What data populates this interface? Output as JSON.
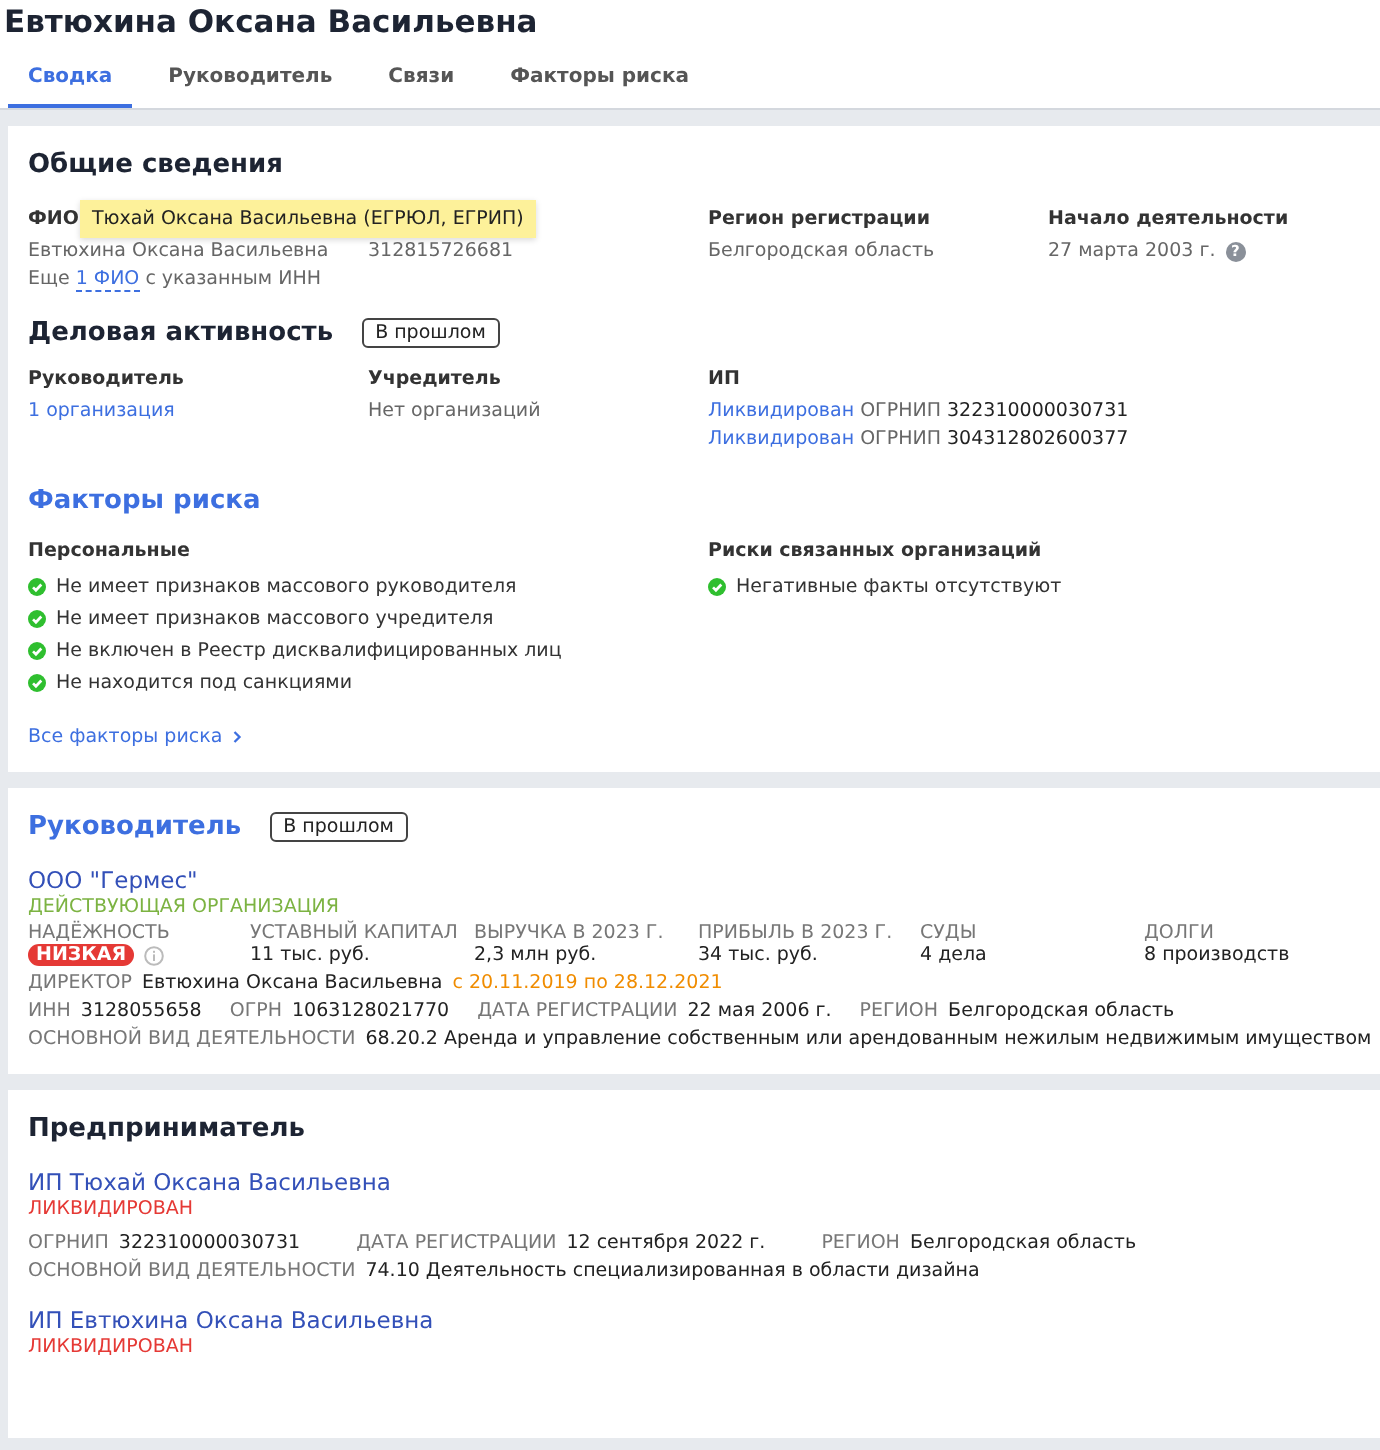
{
  "title": "Евтюхина Оксана Васильевна",
  "tabs": [
    {
      "label": "Сводка",
      "selected": true
    },
    {
      "label": "Руководитель",
      "selected": false
    },
    {
      "label": "Связи",
      "selected": false
    },
    {
      "label": "Факторы риска",
      "selected": false
    }
  ],
  "general": {
    "heading": "Общие сведения",
    "fio_label": "ФИО",
    "fio": "Евтюхина Оксана Васильевна",
    "inn": "312815726681",
    "more_prefix": "Еще",
    "more_link": "1 ФИО",
    "more_suffix": "с указанным ИНН",
    "tooltip": "Тюхай Оксана Васильевна (ЕГРЮЛ, ЕГРИП)",
    "region_label": "Регион регистрации",
    "region": "Белгородская область",
    "start_label": "Начало деятельности",
    "start": "27 марта 2003 г.",
    "start_help": "?"
  },
  "activity": {
    "heading": "Деловая активность",
    "filter": "В прошлом",
    "columns": [
      {
        "label": "Руководитель",
        "lines": [
          {
            "link": "1 организация"
          }
        ]
      },
      {
        "label": "Учредитель",
        "lines": [
          {
            "text": "Нет организаций"
          }
        ]
      },
      {
        "label": "ИП",
        "lines": [
          {
            "link": "Ликвидирован",
            "caption": "ОГРНИП",
            "value": "322310000030731"
          },
          {
            "link": "Ликвидирован",
            "caption": "ОГРНИП",
            "value": "304312802600377"
          }
        ]
      }
    ]
  },
  "risk": {
    "heading": "Факторы риска",
    "groups": [
      {
        "title": "Персональные",
        "items": [
          {
            "text": "Не имеет признаков массового руководителя",
            "ok": true
          },
          {
            "text": "Не имеет признаков массового учредителя",
            "ok": true
          },
          {
            "text": "Не включен в Реестр дисквалифицированных лиц",
            "ok": true
          },
          {
            "text": "Не находится под санкциями",
            "ok": true
          }
        ]
      },
      {
        "title": "Риски связанных организаций",
        "items": [
          {
            "text": "Негативные факты отсутствуют",
            "ok": true
          }
        ]
      }
    ],
    "all_link": "Все факторы риска"
  },
  "manager": {
    "heading": "Руководитель",
    "filter": "В прошлом",
    "company": {
      "name": "ООО \"Гермес\"",
      "status": "ДЕЙСТВУЮЩАЯ ОРГАНИЗАЦИЯ",
      "active": true,
      "metrics": [
        {
          "label": "НАДЁЖНОСТЬ",
          "badge": "НИЗКАЯ"
        },
        {
          "label": "УСТАВНЫЙ КАПИТАЛ",
          "value": "11 тыс. руб."
        },
        {
          "label": "ВЫРУЧКА В 2023 Г.",
          "value": "2,3 млн руб."
        },
        {
          "label": "ПРИБЫЛЬ В 2023 Г.",
          "value": "34 тыс. руб."
        },
        {
          "label": "СУДЫ",
          "value": "4 дела"
        },
        {
          "label": "ДОЛГИ",
          "value": "8 производств"
        }
      ],
      "director_label": "ДИРЕКТОР",
      "director": "Евтюхина Оксана Васильевна",
      "period": "с 20.11.2019 по 28.12.2021",
      "details": [
        [
          {
            "label": "ИНН",
            "value": "3128055658"
          },
          {
            "label": "ОГРН",
            "value": "1063128021770"
          },
          {
            "label": "ДАТА РЕГИСТРАЦИИ",
            "value": "22 мая 2006 г."
          },
          {
            "label": "РЕГИОН",
            "value": "Белгородская область"
          }
        ],
        [
          {
            "label": "ОСНОВНОЙ ВИД ДЕЯТЕЛЬНОСТИ",
            "value": "68.20.2 Аренда и управление собственным или арендованным нежилым недвижимым имуществом"
          }
        ]
      ]
    }
  },
  "entrepreneur": {
    "heading": "Предприниматель",
    "items": [
      {
        "name": "ИП Тюхай Оксана Васильевна",
        "status": "ЛИКВИДИРОВАН",
        "active": false,
        "details": [
          [
            {
              "label": "ОГРНИП",
              "value": "322310000030731"
            },
            {
              "label": "ДАТА РЕГИСТРАЦИИ",
              "value": "12 сентября 2022 г."
            },
            {
              "label": "РЕГИОН",
              "value": "Белгородская область"
            }
          ],
          [
            {
              "label": "ОСНОВНОЙ ВИД ДЕЯТЕЛЬНОСТИ",
              "value": "74.10 Деятельность специализированная в области дизайна"
            }
          ]
        ]
      },
      {
        "name": "ИП Евтюхина Оксана Васильевна",
        "status": "ЛИКВИДИРОВАН",
        "active": false
      }
    ]
  }
}
